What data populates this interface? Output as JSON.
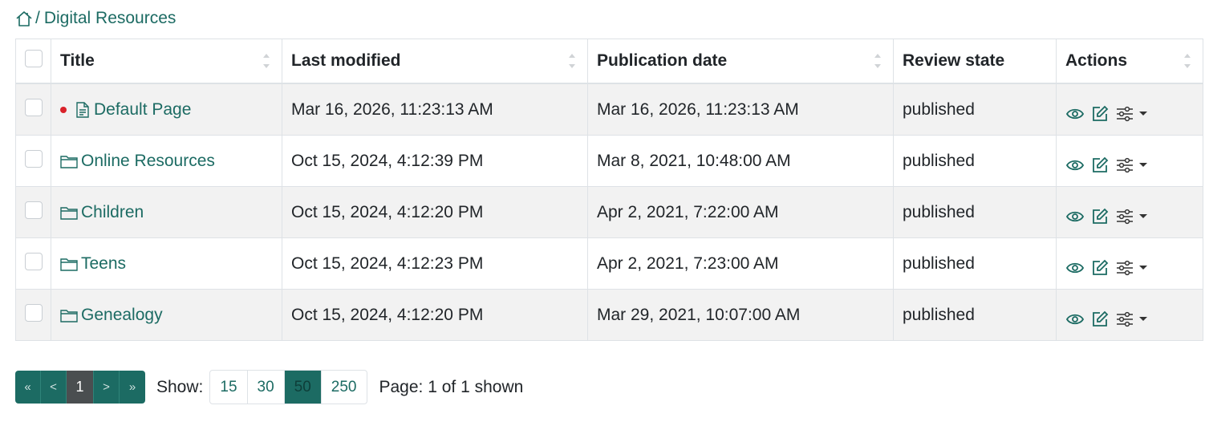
{
  "breadcrumb": {
    "home_icon": "home-icon",
    "separator": "/",
    "current": "Digital Resources"
  },
  "table": {
    "headers": {
      "title": "Title",
      "last_modified": "Last modified",
      "publication_date": "Publication date",
      "review_state": "Review state",
      "actions": "Actions"
    },
    "rows": [
      {
        "type": "document",
        "status_dot": true,
        "title": "Default Page",
        "last_modified": "Mar 16, 2026, 11:23:13 AM",
        "publication_date": "Mar 16, 2026, 11:23:13 AM",
        "review_state": "published"
      },
      {
        "type": "folder",
        "title": "Online Resources",
        "last_modified": "Oct 15, 2024, 4:12:39 PM",
        "publication_date": "Mar 8, 2021, 10:48:00 AM",
        "review_state": "published"
      },
      {
        "type": "folder",
        "title": "Children",
        "last_modified": "Oct 15, 2024, 4:12:20 PM",
        "publication_date": "Apr 2, 2021, 7:22:00 AM",
        "review_state": "published"
      },
      {
        "type": "folder",
        "title": "Teens",
        "last_modified": "Oct 15, 2024, 4:12:23 PM",
        "publication_date": "Apr 2, 2021, 7:23:00 AM",
        "review_state": "published"
      },
      {
        "type": "folder",
        "title": "Genealogy",
        "last_modified": "Oct 15, 2024, 4:12:20 PM",
        "publication_date": "Mar 29, 2021, 10:07:00 AM",
        "review_state": "published"
      }
    ],
    "row_actions": [
      "eye-icon",
      "edit-icon",
      "sliders-icon"
    ]
  },
  "pagination": {
    "first": "«",
    "prev": "<",
    "current_page": "1",
    "next": ">",
    "last": "»"
  },
  "page_size": {
    "label": "Show:",
    "options": [
      "15",
      "30",
      "50",
      "250"
    ],
    "selected": "50"
  },
  "page_info": "Page: 1 of 1 shown",
  "colors": {
    "accent": "#1c6b63",
    "row_stripe": "#f2f2f2",
    "status_dot": "#d9222a",
    "active_page": "#4a4e50"
  }
}
